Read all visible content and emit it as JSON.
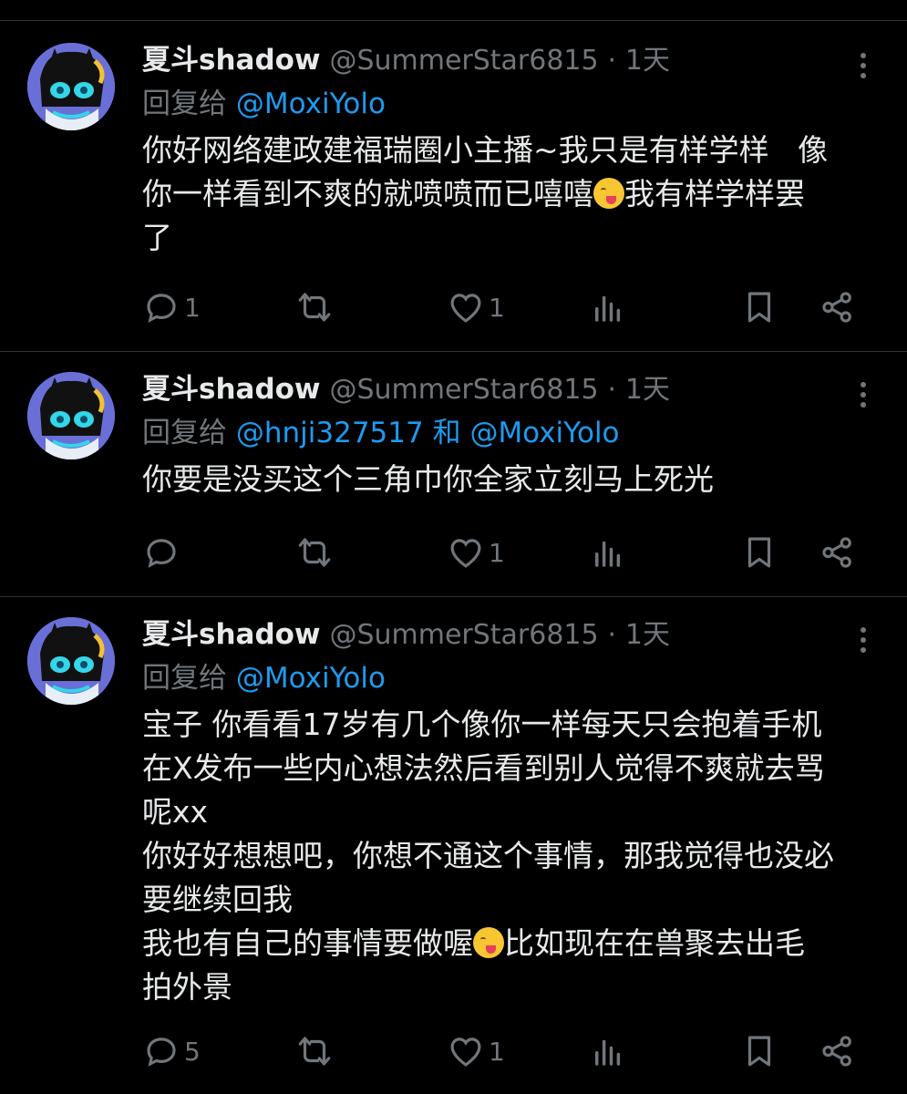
{
  "tweets": [
    {
      "name": "夏斗shadow",
      "handle": "@SummerStar6815",
      "sep": "·",
      "time": "1天",
      "reply_prefix": "回复给",
      "mentions": [
        "@MoxiYolo"
      ],
      "mention_joiner": "",
      "body_parts": [
        "你好网络建政建福瑞圈小主播~我只是有样学样   像\n你一样看到不爽的就喷喷而已嘻嘻",
        "我有样学样罢\n了"
      ],
      "emoji_name": "face-savoring-food-emoji",
      "counts": {
        "reply": "1",
        "retweet": "",
        "like": "1"
      }
    },
    {
      "name": "夏斗shadow",
      "handle": "@SummerStar6815",
      "sep": "·",
      "time": "1天",
      "reply_prefix": "回复给",
      "mentions": [
        "@hnji327517",
        "@MoxiYolo"
      ],
      "mention_joiner": "和",
      "body_parts": [
        "你要是没买这个三角巾你全家立刻马上死光"
      ],
      "counts": {
        "reply": "",
        "retweet": "",
        "like": "1"
      }
    },
    {
      "name": "夏斗shadow",
      "handle": "@SummerStar6815",
      "sep": "·",
      "time": "1天",
      "reply_prefix": "回复给",
      "mentions": [
        "@MoxiYolo"
      ],
      "mention_joiner": "",
      "body_parts": [
        "宝子 你看看17岁有几个像你一样每天只会抱着手机\n在X发布一些内心想法然后看到别人觉得不爽就去骂\n呢xx\n你好好想想吧，你想不通这个事情，那我觉得也没必\n要继续回我\n我也有自己的事情要做喔",
        "比如现在在兽聚去出毛\n拍外景"
      ],
      "emoji_name": "face-savoring-food-emoji",
      "counts": {
        "reply": "5",
        "retweet": "",
        "like": "1"
      }
    }
  ],
  "colors": {
    "background": "#000000",
    "text": "#e7e9ea",
    "muted": "#71767b",
    "link": "#1d9bf0",
    "divider": "#2f3336"
  },
  "icons": [
    "reply-icon",
    "retweet-icon",
    "like-icon",
    "views-icon",
    "bookmark-icon",
    "share-icon",
    "more-icon"
  ]
}
